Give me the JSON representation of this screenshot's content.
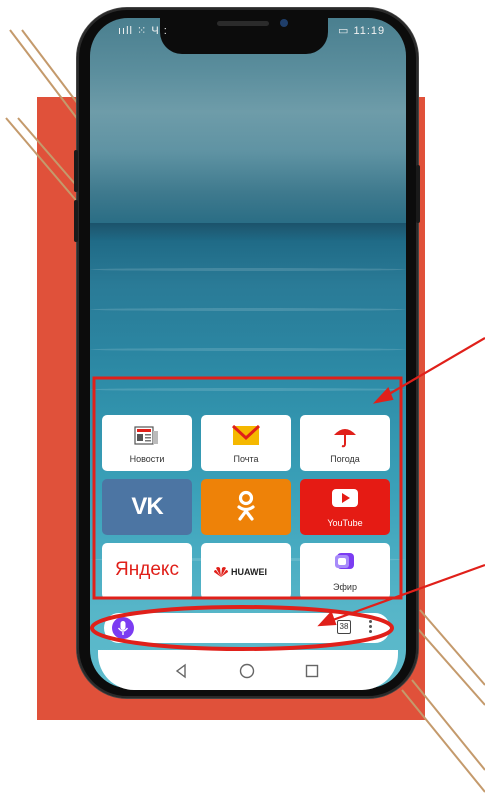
{
  "status_bar": {
    "left": "ııll ⁙ Ч :",
    "right": "▭ 11:19"
  },
  "tiles": [
    {
      "label": "Новости",
      "icon": "news-icon"
    },
    {
      "label": "Почта",
      "icon": "mail-icon"
    },
    {
      "label": "Погода",
      "icon": "umbrella-icon"
    },
    {
      "label": "",
      "icon": "vk-logo-icon",
      "logo_text": "VK"
    },
    {
      "label": "",
      "icon": "odnoklassniki-logo-icon"
    },
    {
      "label": "YouTube",
      "icon": "youtube-play-icon"
    },
    {
      "label": "",
      "icon": "yandex-logo-icon",
      "logo_text": "Яндекс"
    },
    {
      "label": "",
      "icon": "huawei-logo-icon",
      "logo_text": "HUAWEI"
    },
    {
      "label": "Эфир",
      "icon": "efir-icon"
    }
  ],
  "search_bar": {
    "tab_count": "38"
  },
  "colors": {
    "accent_red": "#e0513a",
    "annotation_red": "#e0201a",
    "mic_purple": "#7b3cf2",
    "vk_blue": "#4c75a3",
    "ok_orange": "#ee8208",
    "youtube_red": "#e51b14"
  }
}
